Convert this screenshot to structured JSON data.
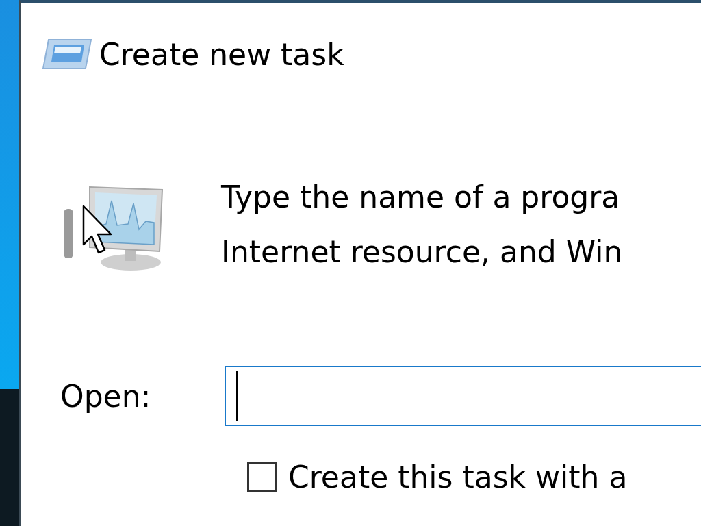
{
  "dialog": {
    "title": "Create new task"
  },
  "message": [
    "Type the name of a progra",
    "Internet resource, and Win"
  ],
  "open_field": {
    "label": "Open:",
    "focused": true
  },
  "admin_option": {
    "label": "Create this task with a",
    "checked": false
  }
}
